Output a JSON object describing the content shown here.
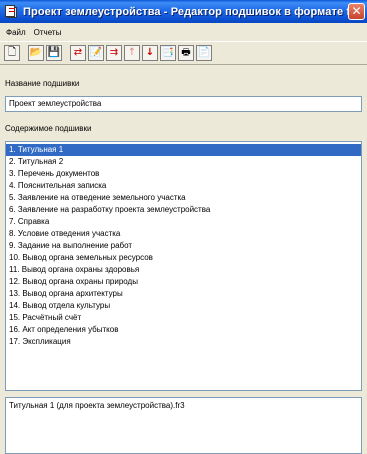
{
  "window": {
    "title": "Проект землеустройства - Редактор подшивок в формате fb3",
    "close_glyph": "✕"
  },
  "menu": [
    "Файл",
    "Отчеты"
  ],
  "toolbar": {
    "buttons": [
      {
        "name": "new-icon",
        "glyph": "🗋"
      },
      {
        "name": "open-icon",
        "glyph": "📂"
      },
      {
        "name": "save-icon",
        "glyph": "💾"
      },
      {
        "name": "add-item-icon",
        "glyph": "⇄"
      },
      {
        "name": "edit-item-icon",
        "glyph": "📝"
      },
      {
        "name": "insert-item-icon",
        "glyph": "⇉"
      },
      {
        "name": "arrow-up-icon",
        "glyph": "↑"
      },
      {
        "name": "arrow-down-icon",
        "glyph": "↓"
      },
      {
        "name": "export-icon",
        "glyph": "📑"
      },
      {
        "name": "print-icon",
        "glyph": "🖶"
      },
      {
        "name": "copy-icon",
        "glyph": "📄"
      }
    ]
  },
  "binder": {
    "name_label": "Название подшивки",
    "name_value": "Проект землеустройства",
    "content_label": "Содержимое подшивки",
    "items": [
      "1. Титульная 1",
      "2. Титульная 2",
      "3. Перечень документов",
      "4. Пояснительная записка",
      "5. Заявление на отведение земельного участка",
      "6. Заявление на разработку проекта землеустройства",
      "7. Справка",
      "8. Условие отведения участка",
      "9. Задание на выполнение работ",
      "10. Вывод органа земельных ресурсов",
      "11. Вывод органа охраны здоровья",
      "12. Вывод органа охраны природы",
      "13. Вывод органа архитектуры",
      "14. Вывод отдела культуры",
      "15. Расчётный счёт",
      "16. Акт определения убытков",
      "17. Экспликация"
    ],
    "selected_index": 0,
    "details": "Титульная 1 (для проекта землеустройства).fr3"
  },
  "colors": {
    "titlebar": "#0b4fd0",
    "selection": "#316ac5",
    "window_bg": "#ece9d8"
  }
}
